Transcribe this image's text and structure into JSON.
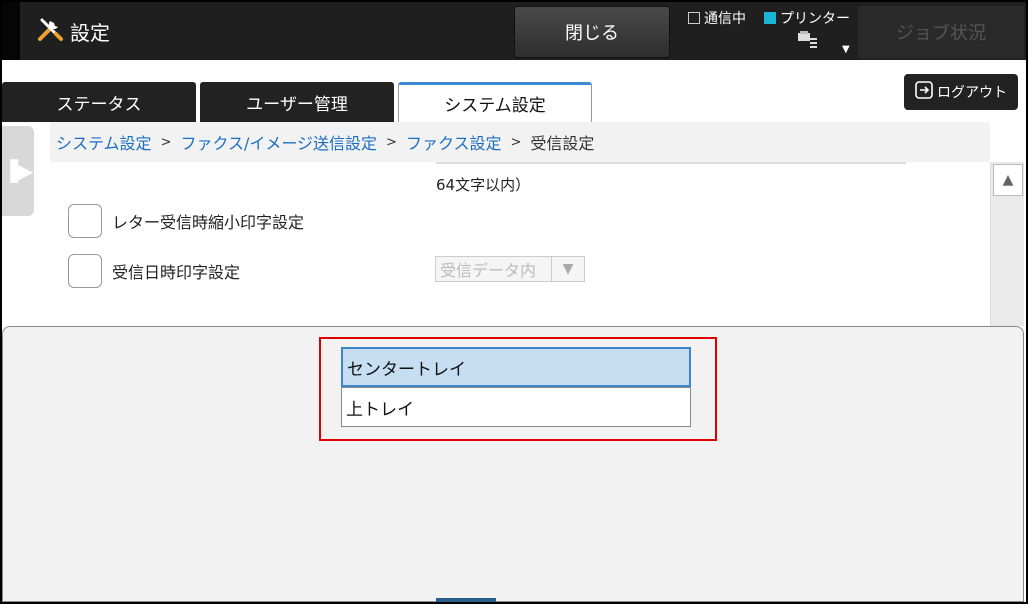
{
  "header": {
    "title": "設定",
    "close_label": "閉じる",
    "status_comm_label": "通信中",
    "status_printer_label": "プリンター",
    "job_status_label": "ジョブ状況"
  },
  "tabs": [
    {
      "label": "ステータス",
      "active": false
    },
    {
      "label": "ユーザー管理",
      "active": false
    },
    {
      "label": "システム設定",
      "active": true
    }
  ],
  "logout_label": "ログアウト",
  "breadcrumb": {
    "item1": "システム設定",
    "item2": "ファクス/イメージ送信設定",
    "item3": "ファクス設定",
    "current": "受信設定",
    "separator": ">"
  },
  "content": {
    "note": "64文字以内）",
    "row1_label": "レター受信時縮小印字設定",
    "row2_label": "受信日時印字設定",
    "select_value": "受信データ内"
  },
  "options": [
    {
      "label": "センタートレイ",
      "selected": true
    },
    {
      "label": "上トレイ",
      "selected": false
    }
  ],
  "colors": {
    "accent": "#1a6fc4",
    "selected_bg": "#c6def2",
    "highlight_border": "#e00000",
    "printer_status": "#1ab5d6"
  }
}
